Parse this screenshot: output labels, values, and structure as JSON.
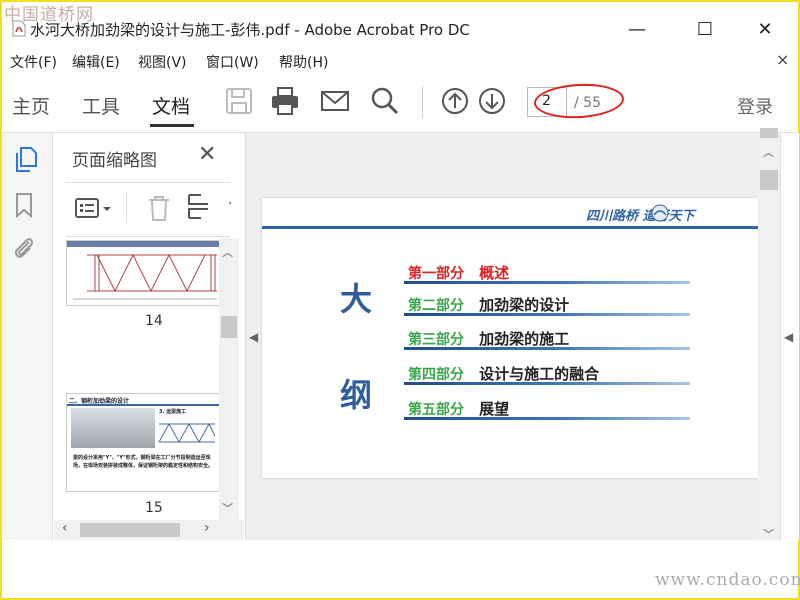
{
  "watermark_top": "中国道桥网",
  "window": {
    "title": "水河大桥加劲梁的设计与施工-彭伟.pdf - Adobe Acrobat Pro DC",
    "minimize": "—",
    "maximize": "☐",
    "close": "✕"
  },
  "menu": {
    "items": [
      "文件(F)",
      "编辑(E)",
      "视图(V)",
      "窗口(W)",
      "帮助(H)"
    ],
    "close": "×"
  },
  "toolbar": {
    "tabs": [
      "主页",
      "工具",
      "文档"
    ],
    "page_current": "2",
    "page_total": "/ 55",
    "login": "登录"
  },
  "thumbnails": {
    "title": "页面缩略图",
    "close": "✕",
    "pages": [
      {
        "number": "14"
      },
      {
        "number": "15",
        "header": "二、钢桁加劲梁的设计",
        "caption": "3. 运梁施工",
        "body": "梁的设计采用\"Y\"、\"Y\"形式，钢桁梁在工厂分节段制造运至现场，在现场安装拼装成整体，保证钢桁架的稳定性和结构安全。"
      }
    ]
  },
  "slide": {
    "logo_text": "四川路桥  道行天下",
    "big_chars": [
      "大",
      "纲"
    ],
    "sections": [
      {
        "num": "第一部分",
        "title": "概述",
        "highlight": true
      },
      {
        "num": "第二部分",
        "title": "加劲梁的设计",
        "highlight": false
      },
      {
        "num": "第三部分",
        "title": "加劲梁的施工",
        "highlight": false
      },
      {
        "num": "第四部分",
        "title": "设计与施工的融合",
        "highlight": false
      },
      {
        "num": "第五部分",
        "title": "展望",
        "highlight": false
      }
    ]
  },
  "watermark_bottom": "www.cndao.com",
  "colors": {
    "highlight_red": "#e02020",
    "section_green": "#3aa64a",
    "big_char_blue": "#2f5d99",
    "annotation_red": "#e0211d",
    "frame_yellow": "#f2e01c"
  }
}
